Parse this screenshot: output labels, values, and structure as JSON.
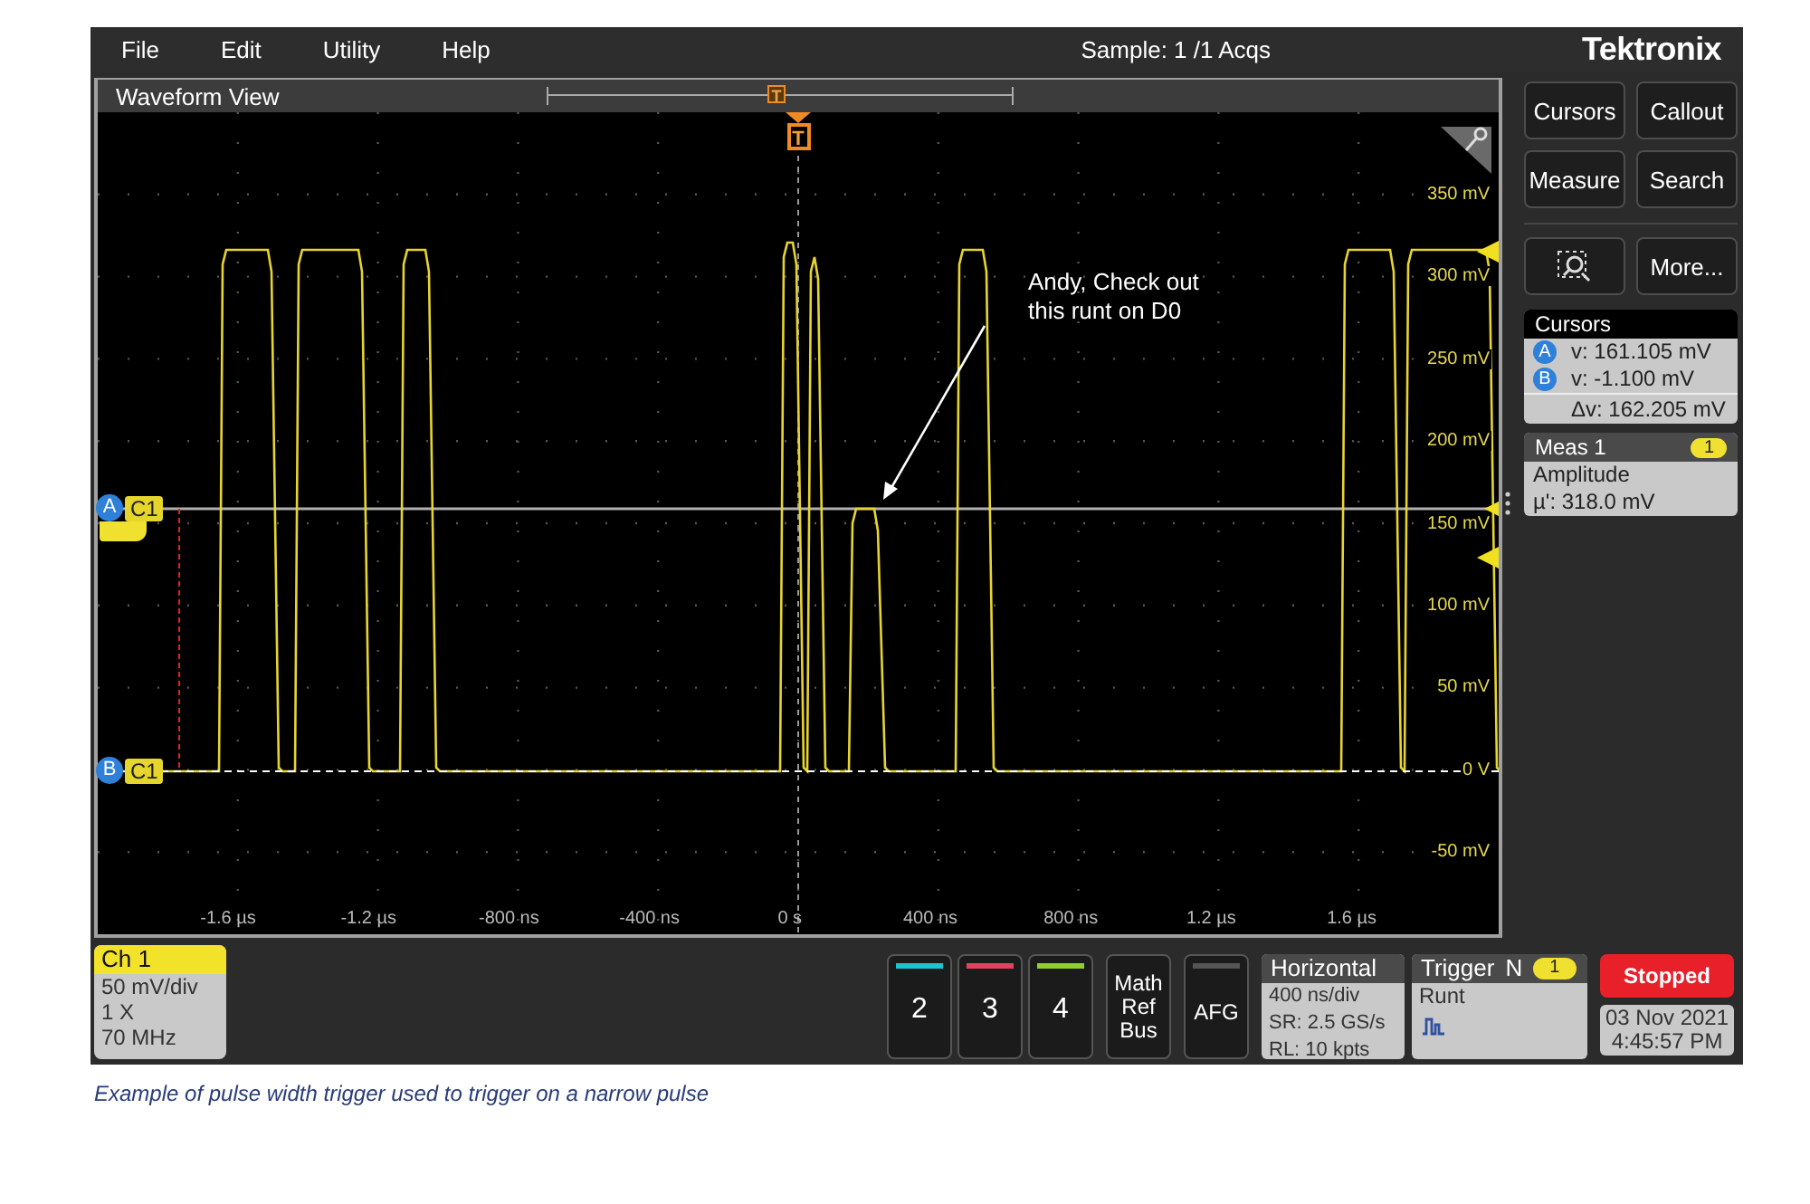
{
  "menu": [
    "File",
    "Edit",
    "Utility",
    "Help"
  ],
  "acquisition_status": "Sample: 1 /1 Acqs",
  "brand": "Tektronix",
  "waveform_view": {
    "title": "Waveform View",
    "record_marker": "T",
    "trigger_marker": "T",
    "y_labels": [
      "350 mV",
      "300 mV",
      "250 mV",
      "200 mV",
      "150 mV",
      "100 mV",
      "50 mV",
      "0 V",
      "-50 mV"
    ],
    "x_labels": [
      "-1.6 µs",
      "-1.2 µs",
      "-800 ns",
      "-400 ns",
      "0 s",
      "400 ns",
      "800 ns",
      "1.2 µs",
      "1.6 µs"
    ],
    "cursor_tags": [
      {
        "cursor": "A",
        "channel": "C1"
      },
      {
        "cursor": "B",
        "channel": "C1"
      }
    ],
    "callout": "Andy, Check out this runt on D0"
  },
  "side_buttons": [
    {
      "kind": "text",
      "label": "Cursors"
    },
    {
      "kind": "text",
      "label": "Callout"
    },
    {
      "kind": "text",
      "label": "Measure"
    },
    {
      "kind": "text",
      "label": "Search"
    },
    {
      "kind": "icon"
    },
    {
      "kind": "text",
      "label": "More..."
    }
  ],
  "cursors_panel": {
    "title": "Cursors",
    "readouts": [
      {
        "cursor": "A",
        "value": "v: 161.105 mV"
      },
      {
        "cursor": "B",
        "value": "v: -1.100 mV"
      }
    ],
    "delta": "Δv: 162.205 mV"
  },
  "measurement": {
    "title": "Meas 1",
    "badge": "1",
    "name": "Amplitude",
    "value": "µ': 318.0 mV"
  },
  "channel": {
    "title": "Ch 1",
    "lines": [
      "50 mV/div",
      "1 X",
      "70 MHz"
    ]
  },
  "channel_buttons": [
    {
      "label": "2",
      "color": "#1cc4d2"
    },
    {
      "label": "3",
      "color": "#e5405c"
    },
    {
      "label": "4",
      "color": "#8fd12c"
    }
  ],
  "math_button": [
    "Math",
    "Ref",
    "Bus"
  ],
  "afg_button": "AFG",
  "horizontal": {
    "title": "Horizontal",
    "lines": [
      "400 ns/div",
      "SR: 2.5 GS/s",
      "RL: 10 kpts"
    ]
  },
  "trigger": {
    "title": "Trigger",
    "mode": "N",
    "badge": "1",
    "type": "Runt"
  },
  "run_state": "Stopped",
  "date": "03 Nov 2021",
  "time": "4:45:57 PM",
  "caption": "Example of pulse width trigger used to trigger on a narrow pulse"
}
